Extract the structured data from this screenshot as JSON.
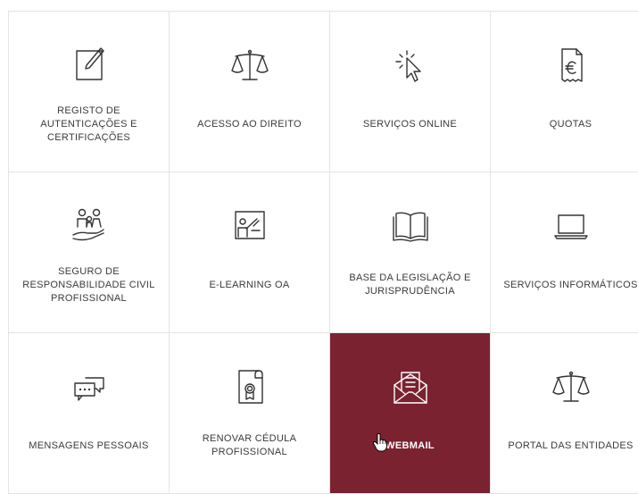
{
  "tiles": [
    {
      "label": "REGISTO DE AUTENTICAÇÕES E CERTIFICAÇÕES",
      "icon": "edit-document-icon"
    },
    {
      "label": "ACESSO AO DIREITO",
      "icon": "scales-icon"
    },
    {
      "label": "SERVIÇOS ONLINE",
      "icon": "cursor-click-icon"
    },
    {
      "label": "QUOTAS",
      "icon": "euro-receipt-icon"
    },
    {
      "label": "SEGURO DE RESPONSABILIDADE CIVIL PROFISSIONAL",
      "icon": "family-hand-icon"
    },
    {
      "label": "E-LEARNING OA",
      "icon": "teacher-board-icon"
    },
    {
      "label": "BASE DA LEGISLAÇÃO E JURISPRUDÊNCIA",
      "icon": "open-book-icon"
    },
    {
      "label": "SERVIÇOS INFORMÁTICOS",
      "icon": "laptop-icon"
    },
    {
      "label": "MENSAGENS PESSOAIS",
      "icon": "chat-bubbles-icon"
    },
    {
      "label": "RENOVAR CÉDULA PROFISSIONAL",
      "icon": "certificate-scroll-icon"
    },
    {
      "label": "WEBMAIL",
      "icon": "envelope-open-icon"
    },
    {
      "label": "PORTAL DAS ENTIDADES",
      "icon": "scales-icon"
    }
  ],
  "active_tile": "WEBMAIL",
  "colors": {
    "active_background": "#7a2230",
    "border": "#e4e4e4",
    "text": "#333333"
  }
}
